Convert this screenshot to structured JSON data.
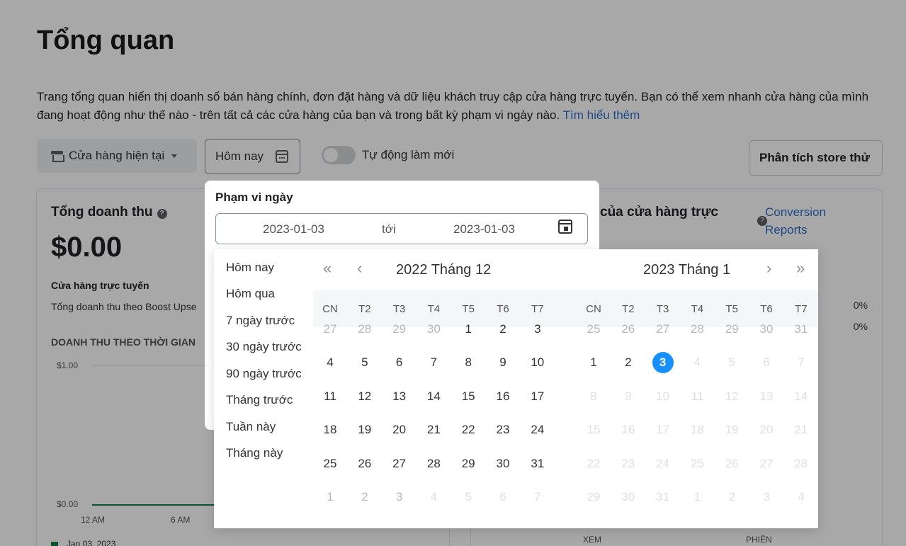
{
  "page": {
    "title": "Tổng quan",
    "description": "Trang tổng quan hiển thị doanh số bán hàng chính, đơn đặt hàng và dữ liệu khách truy cập cửa hàng trực tuyến. Bạn có thể xem nhanh cửa hàng của mình đang hoạt động như thế nào - trên tất cả các cửa hàng của bạn và trong bất kỳ phạm vi ngày nào.",
    "learn_more": "Tìm hiểu thêm"
  },
  "toolbar": {
    "store_label": "Cửa hàng hiện tại",
    "date_label": "Hôm nay",
    "auto_refresh_label": "Tự động làm mới",
    "auto_refresh_on": false,
    "analysis_label": "Phân tích store thử"
  },
  "card_sales": {
    "title": "Tổng doanh thu",
    "total": "$0.00",
    "subtitle": "Cửa hàng trực tuyến",
    "subdesc": "Tổng doanh thu theo Boost Upse",
    "section": "DOANH THU THEO THỜI GIAN",
    "y_top": "$1.00",
    "y_bottom": "$0.00",
    "x_ticks": [
      "12 AM",
      "6 AM"
    ],
    "legend": "Jan 03, 2023"
  },
  "card_conversion": {
    "title": "của cửa hàng trực",
    "link": "Conversion Reports",
    "pct1": "0%",
    "pct2": "0%",
    "x_ticks": [
      "XEM",
      "PHIÊN"
    ]
  },
  "popover": {
    "title": "Phạm vi ngày",
    "start": "2023-01-03",
    "to": "tới",
    "end": "2023-01-03"
  },
  "presets": [
    "Hôm nay",
    "Hôm qua",
    "7 ngày trước",
    "30 ngày trước",
    "90 ngày trước",
    "Tháng trước",
    "Tuần này",
    "Tháng này"
  ],
  "weekdays": [
    "CN",
    "T2",
    "T3",
    "T4",
    "T5",
    "T6",
    "T7"
  ],
  "nav_icons": {
    "prev_year": "«",
    "prev_month": "‹",
    "next_month": "›",
    "next_year": "»"
  },
  "calendars": [
    {
      "title": "2022 Tháng 12",
      "weeks": [
        [
          "27",
          "28",
          "29",
          "30",
          "1",
          "2",
          "3"
        ],
        [
          "4",
          "5",
          "6",
          "7",
          "8",
          "9",
          "10"
        ],
        [
          "11",
          "12",
          "13",
          "14",
          "15",
          "16",
          "17"
        ],
        [
          "18",
          "19",
          "20",
          "21",
          "22",
          "23",
          "24"
        ],
        [
          "25",
          "26",
          "27",
          "28",
          "29",
          "30",
          "31"
        ],
        [
          "1",
          "2",
          "3",
          "4",
          "5",
          "6",
          "7"
        ]
      ],
      "states": [
        [
          "o",
          "o",
          "o",
          "o",
          "n",
          "n",
          "n"
        ],
        [
          "n",
          "n",
          "n",
          "n",
          "n",
          "n",
          "n"
        ],
        [
          "n",
          "n",
          "n",
          "n",
          "n",
          "n",
          "n"
        ],
        [
          "n",
          "n",
          "n",
          "n",
          "n",
          "n",
          "n"
        ],
        [
          "n",
          "n",
          "n",
          "n",
          "n",
          "n",
          "n"
        ],
        [
          "o",
          "o",
          "o",
          "d",
          "d",
          "d",
          "d"
        ]
      ]
    },
    {
      "title": "2023 Tháng 1",
      "weeks": [
        [
          "25",
          "26",
          "27",
          "28",
          "29",
          "30",
          "31"
        ],
        [
          "1",
          "2",
          "3",
          "4",
          "5",
          "6",
          "7"
        ],
        [
          "8",
          "9",
          "10",
          "11",
          "12",
          "13",
          "14"
        ],
        [
          "15",
          "16",
          "17",
          "18",
          "19",
          "20",
          "21"
        ],
        [
          "22",
          "23",
          "24",
          "25",
          "26",
          "27",
          "28"
        ],
        [
          "29",
          "30",
          "31",
          "1",
          "2",
          "3",
          "4"
        ]
      ],
      "states": [
        [
          "o",
          "o",
          "o",
          "o",
          "o",
          "o",
          "o"
        ],
        [
          "n",
          "n",
          "s",
          "d",
          "d",
          "d",
          "d"
        ],
        [
          "d",
          "d",
          "d",
          "d",
          "d",
          "d",
          "d"
        ],
        [
          "d",
          "d",
          "d",
          "d",
          "d",
          "d",
          "d"
        ],
        [
          "d",
          "d",
          "d",
          "d",
          "d",
          "d",
          "d"
        ],
        [
          "d",
          "d",
          "d",
          "d",
          "d",
          "d",
          "d"
        ]
      ]
    }
  ],
  "colors": {
    "accent": "#1890ff",
    "link": "#2c6ecb",
    "chart_line": "#108043"
  }
}
